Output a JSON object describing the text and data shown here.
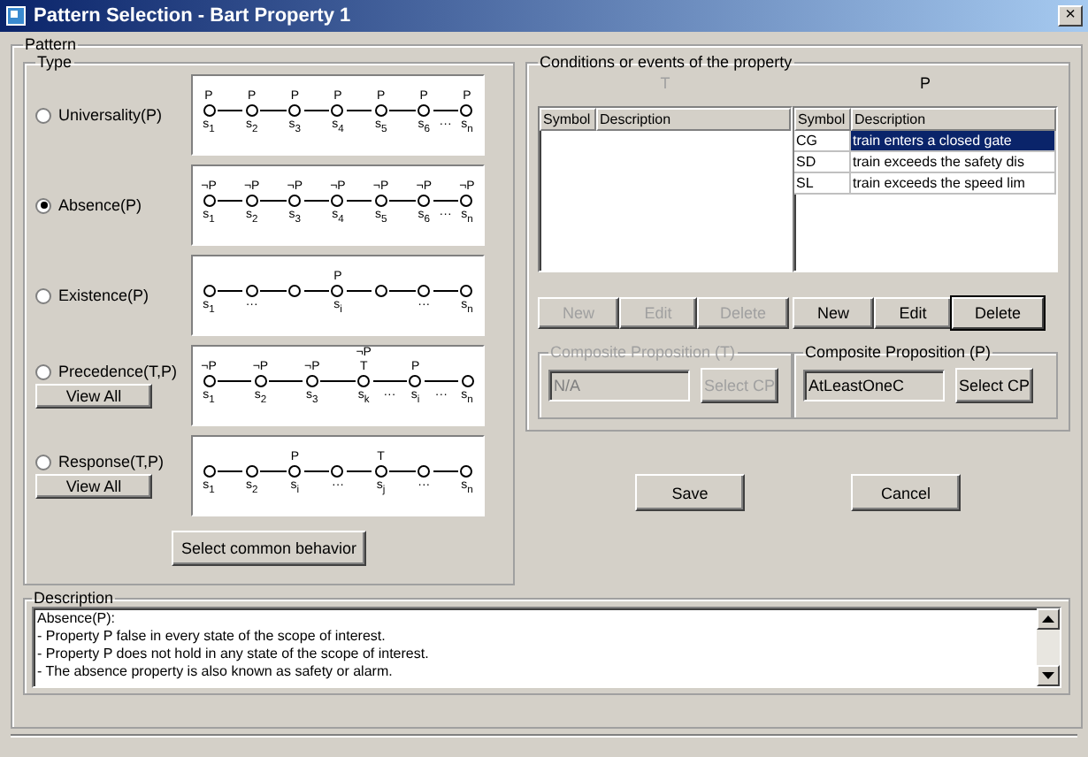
{
  "window": {
    "title": "Pattern Selection - Bart Property 1",
    "close": "×"
  },
  "pattern": {
    "label": "Pattern",
    "type_group": {
      "label": "Type",
      "items": [
        {
          "label": "Universality(P)",
          "selected": false,
          "nodes": [
            {
              "kind": "state",
              "above": "P",
              "below": "s$_{1}$"
            },
            {
              "kind": "state",
              "above": "P",
              "below": "s$_{2}$"
            },
            {
              "kind": "state",
              "above": "P",
              "below": "s$_{3}$"
            },
            {
              "kind": "state",
              "above": "P",
              "below": "s$_{4}$"
            },
            {
              "kind": "state",
              "above": "P",
              "below": "s$_{5}$"
            },
            {
              "kind": "state",
              "above": "P",
              "below": "s$_{6}$",
              "after": "···"
            },
            {
              "kind": "state",
              "above": "P",
              "below": "s$_{n}$"
            }
          ]
        },
        {
          "label": "Absence(P)",
          "selected": true,
          "nodes": [
            {
              "kind": "state",
              "above": "¬P",
              "below": "s$_{1}$"
            },
            {
              "kind": "state",
              "above": "¬P",
              "below": "s$_{2}$"
            },
            {
              "kind": "state",
              "above": "¬P",
              "below": "s$_{3}$"
            },
            {
              "kind": "state",
              "above": "¬P",
              "below": "s$_{4}$"
            },
            {
              "kind": "state",
              "above": "¬P",
              "below": "s$_{5}$"
            },
            {
              "kind": "state",
              "above": "¬P",
              "below": "s$_{6}$",
              "after": "···"
            },
            {
              "kind": "state",
              "above": "¬P",
              "below": "s$_{n}$"
            }
          ]
        },
        {
          "label": "Existence(P)",
          "selected": false,
          "nodes": [
            {
              "kind": "state",
              "below": "s$_{1}$"
            },
            {
              "kind": "state",
              "below": "···"
            },
            {
              "kind": "state"
            },
            {
              "kind": "state",
              "above": "P",
              "below": "s$_{i}$"
            },
            {
              "kind": "state"
            },
            {
              "kind": "state",
              "below": "···"
            },
            {
              "kind": "state",
              "below": "s$_{n}$"
            }
          ]
        },
        {
          "label": "Precedence(T,P)",
          "selected": false,
          "button": "View All",
          "nodes": [
            {
              "kind": "state",
              "above": "¬P",
              "below": "s$_{1}$"
            },
            {
              "kind": "state",
              "above": "¬P",
              "below": "s$_{2}$"
            },
            {
              "kind": "state",
              "above": "¬P",
              "below": "s$_{3}$"
            },
            {
              "kind": "state",
              "above": "¬P",
              "above2": "T",
              "below": "s$_{k}$",
              "after": "···"
            },
            {
              "kind": "state",
              "above": "P",
              "below": "s$_{i}$",
              "after": "···"
            },
            {
              "kind": "state",
              "below": "s$_{n}$"
            }
          ]
        },
        {
          "label": "Response(T,P)",
          "selected": false,
          "button": "View All",
          "nodes": [
            {
              "kind": "state",
              "below": "s$_{1}$"
            },
            {
              "kind": "state",
              "below": "s$_{2}$"
            },
            {
              "kind": "state",
              "above": "P",
              "below": "s$_{i}$"
            },
            {
              "kind": "state",
              "below": "···"
            },
            {
              "kind": "state",
              "above": "T",
              "below": "s$_{j}$"
            },
            {
              "kind": "state",
              "below": "···"
            },
            {
              "kind": "state",
              "below": "s$_{n}$"
            }
          ]
        }
      ],
      "common_button": "Select common behavior"
    },
    "conditions": {
      "label": "Conditions or events of the property",
      "panels": [
        {
          "heading": "T",
          "disabled": true,
          "columns": [
            "Symbol",
            "Description"
          ],
          "buttons": [
            {
              "label": "New",
              "focused": false
            },
            {
              "label": "Edit",
              "focused": false
            },
            {
              "label": "Delete",
              "focused": false
            }
          ],
          "composite": {
            "label": "Composite Proposition (T)",
            "value": "N/A",
            "button": "Select CP"
          }
        },
        {
          "heading": "P",
          "disabled": false,
          "columns": [
            "Symbol",
            "Description"
          ],
          "rows": [
            {
              "symbol": "CG",
              "description": "train enters a closed gate",
              "selected": true
            },
            {
              "symbol": "SD",
              "description": "train exceeds the safety dis",
              "selected": false
            },
            {
              "symbol": "SL",
              "description": "train exceeds the speed lim",
              "selected": false
            }
          ],
          "buttons": [
            {
              "label": "New",
              "focused": false
            },
            {
              "label": "Edit",
              "focused": false
            },
            {
              "label": "Delete",
              "focused": true
            }
          ],
          "composite": {
            "label": "Composite Proposition (P)",
            "value": "AtLeastOneC",
            "button": "Select CP"
          }
        }
      ]
    },
    "actions": [
      "Save",
      "Cancel"
    ],
    "description": {
      "label": "Description",
      "lines": [
        "Absence(P):",
        "- Property P false in every state of the scope of interest.",
        "- Property P does not hold in any state of the scope of interest.",
        "- The absence property is also known as safety or alarm."
      ]
    }
  }
}
